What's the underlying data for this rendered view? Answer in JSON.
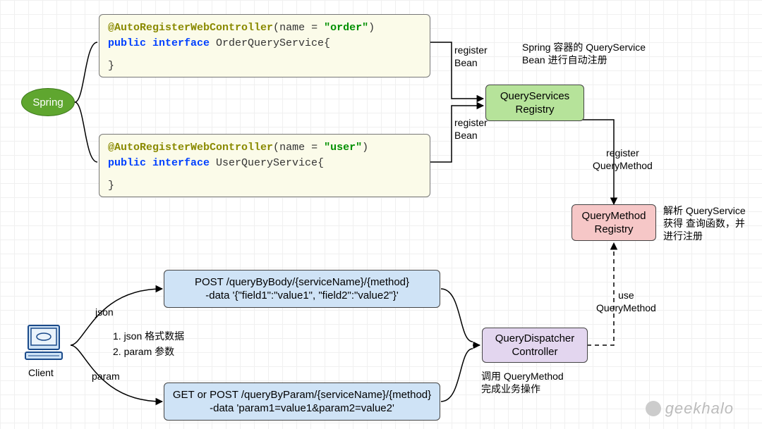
{
  "spring": {
    "label": "Spring"
  },
  "code": {
    "order": {
      "anno_head": "@AutoRegisterWebController",
      "anno_name_key": "name = ",
      "anno_name_val": "\"order\"",
      "line2_a": "public interface ",
      "line2_b": "OrderQueryService{",
      "line3": "}"
    },
    "user": {
      "anno_head": "@AutoRegisterWebController",
      "anno_name_key": "name = ",
      "anno_name_val": "\"user\"",
      "line2_a": "public interface ",
      "line2_b": "UserQueryService{",
      "line3": "}"
    }
  },
  "edges": {
    "register_bean_top": "register\nBean",
    "register_bean_bot": "register\nBean",
    "register_qm": "register\nQueryMethod",
    "use_qm": "use\nQueryMethod",
    "json": "json",
    "param": "param"
  },
  "notes": {
    "qsr": "Spring 容器的 QueryService\nBean 进行自动注册",
    "qmr": "解析 QueryService\n获得 查询函数，并\n进行注册",
    "dispatcher": "调用 QueryMethod\n完成业务操作",
    "client_list_1": "1. json 格式数据",
    "client_list_2": "2. param 参数"
  },
  "nodes": {
    "qsr": "QueryServices\nRegistry",
    "qmr": "QueryMethod\nRegistry",
    "dispatcher": "QueryDispatcher\nController",
    "post_body_l1": "POST /queryByBody/{serviceName}/{method}",
    "post_body_l2": "-data '{\"field1\":\"value1\", \"field2\":\"value2\"}'",
    "get_param_l1": "GET or POST /queryByParam/{serviceName}/{method}",
    "get_param_l2": "-data 'param1=value1&param2=value2'"
  },
  "client": {
    "label": "Client"
  },
  "watermark": "geekhalo"
}
